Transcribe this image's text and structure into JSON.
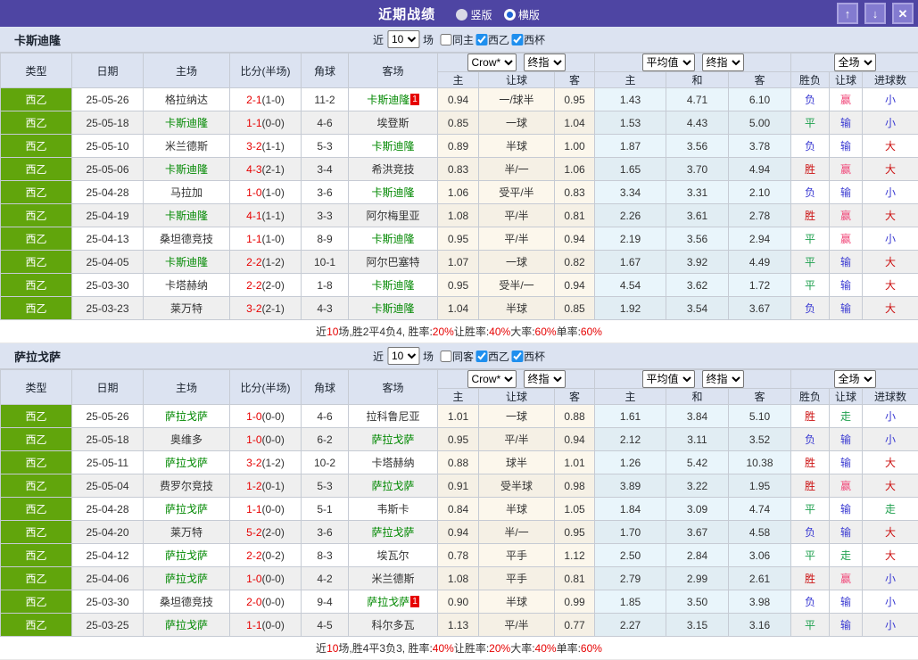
{
  "titlebar": {
    "title": "近期战绩",
    "vertical_label": "竖版",
    "horizontal_label": "横版",
    "vertical_checked": false,
    "horizontal_checked": true,
    "up_icon": "↑",
    "down_icon": "↓",
    "close_icon": "✕"
  },
  "colors": {
    "titlebar_bg": "#4e45a3",
    "section_head_bg": "#dce3f1",
    "league_cell_bg": "#61a50c",
    "team_name_green": "#008800",
    "score_red": "#e60000",
    "win_red": "#cc1111",
    "handicap_win_pink": "#f0487a",
    "draw_green": "#1fa04e",
    "lose_blue": "#3a3ad2",
    "checkbox_blue": "#1f8fee"
  },
  "table_header": {
    "main_cols": [
      "类型",
      "日期",
      "主场",
      "比分(半场)",
      "角球",
      "客场"
    ],
    "group1_selects": [
      "Crow*",
      "终指"
    ],
    "group2_selects": [
      "平均值",
      "终指"
    ],
    "group3_selects": [
      "全场"
    ],
    "sub_cols": [
      "主",
      "让球",
      "客",
      "主",
      "和",
      "客",
      "胜负",
      "让球",
      "进球数"
    ]
  },
  "sections": [
    {
      "team": "卡斯迪隆",
      "filter": {
        "near": "近",
        "count": "10",
        "games": "场",
        "same_label": "同主",
        "same_checked": false,
        "league_label": "西乙",
        "league_checked": true,
        "cup_label": "西杯",
        "cup_checked": true
      },
      "rows": [
        {
          "league": "西乙",
          "date": "25-05-26",
          "home": "格拉纳达",
          "score": "2-1",
          "half": "(1-0)",
          "corner": "11-2",
          "away": "卡斯迪隆",
          "away_badge": "1",
          "crow": [
            "0.94",
            "一/球半",
            "0.95"
          ],
          "avg": [
            "1.43",
            "4.71",
            "6.10"
          ],
          "results": [
            "负",
            "赢",
            "小"
          ]
        },
        {
          "league": "西乙",
          "date": "25-05-18",
          "home": "卡斯迪隆",
          "score": "1-1",
          "half": "(0-0)",
          "corner": "4-6",
          "away": "埃登斯",
          "crow": [
            "0.85",
            "一球",
            "1.04"
          ],
          "avg": [
            "1.53",
            "4.43",
            "5.00"
          ],
          "results": [
            "平",
            "输",
            "小"
          ]
        },
        {
          "league": "西乙",
          "date": "25-05-10",
          "home": "米兰德斯",
          "score": "3-2",
          "half": "(1-1)",
          "corner": "5-3",
          "away": "卡斯迪隆",
          "crow": [
            "0.89",
            "半球",
            "1.00"
          ],
          "avg": [
            "1.87",
            "3.56",
            "3.78"
          ],
          "results": [
            "负",
            "输",
            "大"
          ]
        },
        {
          "league": "西乙",
          "date": "25-05-06",
          "home": "卡斯迪隆",
          "score": "4-3",
          "half": "(2-1)",
          "corner": "3-4",
          "away": "希洪竞技",
          "crow": [
            "0.83",
            "半/一",
            "1.06"
          ],
          "avg": [
            "1.65",
            "3.70",
            "4.94"
          ],
          "results": [
            "胜",
            "赢",
            "大"
          ]
        },
        {
          "league": "西乙",
          "date": "25-04-28",
          "home": "马拉加",
          "score": "1-0",
          "half": "(1-0)",
          "corner": "3-6",
          "away": "卡斯迪隆",
          "crow": [
            "1.06",
            "受平/半",
            "0.83"
          ],
          "avg": [
            "3.34",
            "3.31",
            "2.10"
          ],
          "results": [
            "负",
            "输",
            "小"
          ]
        },
        {
          "league": "西乙",
          "date": "25-04-19",
          "home": "卡斯迪隆",
          "score": "4-1",
          "half": "(1-1)",
          "corner": "3-3",
          "away": "阿尔梅里亚",
          "crow": [
            "1.08",
            "平/半",
            "0.81"
          ],
          "avg": [
            "2.26",
            "3.61",
            "2.78"
          ],
          "results": [
            "胜",
            "赢",
            "大"
          ]
        },
        {
          "league": "西乙",
          "date": "25-04-13",
          "home": "桑坦德竞技",
          "score": "1-1",
          "half": "(1-0)",
          "corner": "8-9",
          "away": "卡斯迪隆",
          "crow": [
            "0.95",
            "平/半",
            "0.94"
          ],
          "avg": [
            "2.19",
            "3.56",
            "2.94"
          ],
          "results": [
            "平",
            "赢",
            "小"
          ]
        },
        {
          "league": "西乙",
          "date": "25-04-05",
          "home": "卡斯迪隆",
          "score": "2-2",
          "half": "(1-2)",
          "corner": "10-1",
          "away": "阿尔巴塞特",
          "crow": [
            "1.07",
            "一球",
            "0.82"
          ],
          "avg": [
            "1.67",
            "3.92",
            "4.49"
          ],
          "results": [
            "平",
            "输",
            "大"
          ]
        },
        {
          "league": "西乙",
          "date": "25-03-30",
          "home": "卡塔赫纳",
          "score": "2-2",
          "half": "(2-0)",
          "corner": "1-8",
          "away": "卡斯迪隆",
          "crow": [
            "0.95",
            "受半/一",
            "0.94"
          ],
          "avg": [
            "4.54",
            "3.62",
            "1.72"
          ],
          "results": [
            "平",
            "输",
            "大"
          ]
        },
        {
          "league": "西乙",
          "date": "25-03-23",
          "home": "莱万特",
          "score": "3-2",
          "half": "(2-1)",
          "corner": "4-3",
          "away": "卡斯迪隆",
          "crow": [
            "1.04",
            "半球",
            "0.85"
          ],
          "avg": [
            "1.92",
            "3.54",
            "3.67"
          ],
          "results": [
            "负",
            "输",
            "大"
          ]
        }
      ],
      "summary": [
        [
          "近",
          0
        ],
        [
          "10",
          1
        ],
        [
          "场,胜2平4负4, 胜率:",
          0
        ],
        [
          "20%",
          1
        ],
        [
          " 让胜率:",
          0
        ],
        [
          "40%",
          1
        ],
        [
          " 大率:",
          0
        ],
        [
          "60%",
          1
        ],
        [
          " 单率:",
          0
        ],
        [
          "60%",
          1
        ]
      ]
    },
    {
      "team": "萨拉戈萨",
      "filter": {
        "near": "近",
        "count": "10",
        "games": "场",
        "same_label": "同客",
        "same_checked": false,
        "league_label": "西乙",
        "league_checked": true,
        "cup_label": "西杯",
        "cup_checked": true
      },
      "rows": [
        {
          "league": "西乙",
          "date": "25-05-26",
          "home": "萨拉戈萨",
          "score": "1-0",
          "half": "(0-0)",
          "corner": "4-6",
          "away": "拉科鲁尼亚",
          "crow": [
            "1.01",
            "一球",
            "0.88"
          ],
          "avg": [
            "1.61",
            "3.84",
            "5.10"
          ],
          "results": [
            "胜",
            "走",
            "小"
          ]
        },
        {
          "league": "西乙",
          "date": "25-05-18",
          "home": "奥维多",
          "score": "1-0",
          "half": "(0-0)",
          "corner": "6-2",
          "away": "萨拉戈萨",
          "crow": [
            "0.95",
            "平/半",
            "0.94"
          ],
          "avg": [
            "2.12",
            "3.11",
            "3.52"
          ],
          "results": [
            "负",
            "输",
            "小"
          ]
        },
        {
          "league": "西乙",
          "date": "25-05-11",
          "home": "萨拉戈萨",
          "score": "3-2",
          "half": "(1-2)",
          "corner": "10-2",
          "away": "卡塔赫纳",
          "crow": [
            "0.88",
            "球半",
            "1.01"
          ],
          "avg": [
            "1.26",
            "5.42",
            "10.38"
          ],
          "results": [
            "胜",
            "输",
            "大"
          ]
        },
        {
          "league": "西乙",
          "date": "25-05-04",
          "home": "费罗尔竞技",
          "score": "1-2",
          "half": "(0-1)",
          "corner": "5-3",
          "away": "萨拉戈萨",
          "crow": [
            "0.91",
            "受半球",
            "0.98"
          ],
          "avg": [
            "3.89",
            "3.22",
            "1.95"
          ],
          "results": [
            "胜",
            "赢",
            "大"
          ]
        },
        {
          "league": "西乙",
          "date": "25-04-28",
          "home": "萨拉戈萨",
          "score": "1-1",
          "half": "(0-0)",
          "corner": "5-1",
          "away": "韦斯卡",
          "crow": [
            "0.84",
            "半球",
            "1.05"
          ],
          "avg": [
            "1.84",
            "3.09",
            "4.74"
          ],
          "results": [
            "平",
            "输",
            "走"
          ]
        },
        {
          "league": "西乙",
          "date": "25-04-20",
          "home": "莱万特",
          "score": "5-2",
          "half": "(2-0)",
          "corner": "3-6",
          "away": "萨拉戈萨",
          "crow": [
            "0.94",
            "半/一",
            "0.95"
          ],
          "avg": [
            "1.70",
            "3.67",
            "4.58"
          ],
          "results": [
            "负",
            "输",
            "大"
          ]
        },
        {
          "league": "西乙",
          "date": "25-04-12",
          "home": "萨拉戈萨",
          "score": "2-2",
          "half": "(0-2)",
          "corner": "8-3",
          "away": "埃瓦尔",
          "crow": [
            "0.78",
            "平手",
            "1.12"
          ],
          "avg": [
            "2.50",
            "2.84",
            "3.06"
          ],
          "results": [
            "平",
            "走",
            "大"
          ]
        },
        {
          "league": "西乙",
          "date": "25-04-06",
          "home": "萨拉戈萨",
          "score": "1-0",
          "half": "(0-0)",
          "corner": "4-2",
          "away": "米兰德斯",
          "crow": [
            "1.08",
            "平手",
            "0.81"
          ],
          "avg": [
            "2.79",
            "2.99",
            "2.61"
          ],
          "results": [
            "胜",
            "赢",
            "小"
          ]
        },
        {
          "league": "西乙",
          "date": "25-03-30",
          "home": "桑坦德竞技",
          "score": "2-0",
          "half": "(0-0)",
          "corner": "9-4",
          "away": "萨拉戈萨",
          "away_badge": "1",
          "crow": [
            "0.90",
            "半球",
            "0.99"
          ],
          "avg": [
            "1.85",
            "3.50",
            "3.98"
          ],
          "results": [
            "负",
            "输",
            "小"
          ]
        },
        {
          "league": "西乙",
          "date": "25-03-25",
          "home": "萨拉戈萨",
          "score": "1-1",
          "half": "(0-0)",
          "corner": "4-5",
          "away": "科尔多瓦",
          "crow": [
            "1.13",
            "平/半",
            "0.77"
          ],
          "avg": [
            "2.27",
            "3.15",
            "3.16"
          ],
          "results": [
            "平",
            "输",
            "小"
          ]
        }
      ],
      "summary": [
        [
          "近",
          0
        ],
        [
          "10",
          1
        ],
        [
          "场,胜4平3负3, 胜率:",
          0
        ],
        [
          "40%",
          1
        ],
        [
          " 让胜率:",
          0
        ],
        [
          "20%",
          1
        ],
        [
          " 大率:",
          0
        ],
        [
          "40%",
          1
        ],
        [
          " 单率:",
          0
        ],
        [
          "60%",
          1
        ]
      ]
    }
  ]
}
